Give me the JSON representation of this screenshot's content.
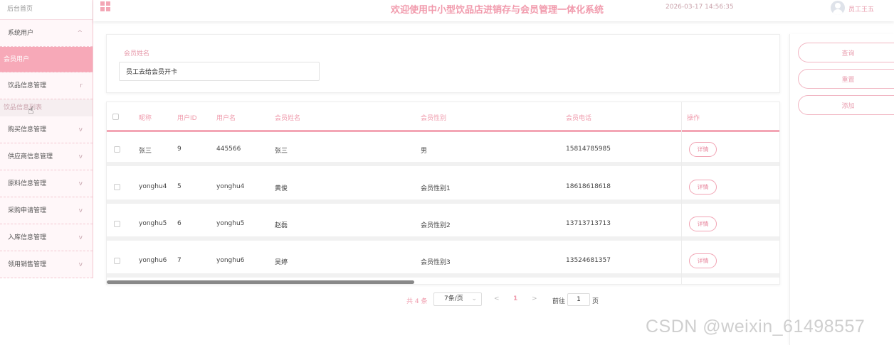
{
  "sidebar": {
    "home": "后台首页",
    "items": [
      {
        "label": "系统用户",
        "chevron": "^"
      },
      {
        "label": "会员用户",
        "chevron": ""
      },
      {
        "label": "饮品信息管理",
        "chevron": "r"
      },
      {
        "label": "饮品信息列表",
        "chevron": ""
      },
      {
        "label": "购买信息管理",
        "chevron": "v"
      },
      {
        "label": "供应商信息管理",
        "chevron": "v"
      },
      {
        "label": "原料信息管理",
        "chevron": "v"
      },
      {
        "label": "采购申请管理",
        "chevron": "v"
      },
      {
        "label": "入库信息管理",
        "chevron": "v"
      },
      {
        "label": "领用销售管理",
        "chevron": "v"
      }
    ]
  },
  "header": {
    "title": "欢迎使用中小型饮品店进销存与会员管理一体化系统",
    "datetime": "2026-03-17 14:56:35",
    "username": "员工王五"
  },
  "search": {
    "label": "会员姓名",
    "value": "员工去给会员开卡"
  },
  "table": {
    "columns": [
      "昵称",
      "用户ID",
      "用户名",
      "会员姓名",
      "会员性别",
      "会员电话",
      "操作"
    ],
    "rows": [
      {
        "nickname": "张三",
        "uid": "9",
        "username": "445566",
        "name": "张三",
        "gender": "男",
        "phone": "15814785985",
        "action": "详情"
      },
      {
        "nickname": "yonghu4",
        "uid": "5",
        "username": "yonghu4",
        "name": "黄俊",
        "gender": "会员性别1",
        "phone": "18618618618",
        "action": "详情"
      },
      {
        "nickname": "yonghu5",
        "uid": "6",
        "username": "yonghu5",
        "name": "赵磊",
        "gender": "会员性别2",
        "phone": "13713713713",
        "action": "详情"
      },
      {
        "nickname": "yonghu6",
        "uid": "7",
        "username": "yonghu6",
        "name": "吴婷",
        "gender": "会员性别3",
        "phone": "13524681357",
        "action": "详情"
      }
    ]
  },
  "pager": {
    "total": "共 4 条",
    "page_size": "7条/页",
    "prev": "<",
    "current": "1",
    "next": ">",
    "goto": "前往",
    "goto_value": "1",
    "page_suffix": "页"
  },
  "actions": {
    "query": "查询",
    "reset": "重置",
    "add": "添加"
  },
  "watermark": "CSDN @weixin_61498557",
  "colors": {
    "accent": "#f3a6b5",
    "accent_text": "#ef9aab"
  }
}
